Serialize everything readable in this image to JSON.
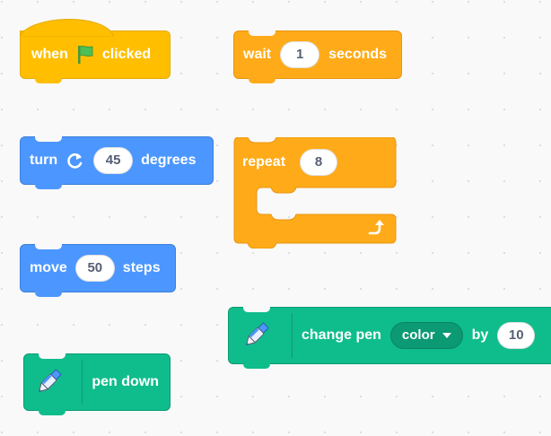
{
  "blocks": {
    "when_flag": {
      "prefix": "when",
      "suffix": "clicked",
      "flag_color": "#4cbf56"
    },
    "wait": {
      "label": "wait",
      "value": "1",
      "unit": "seconds"
    },
    "turn": {
      "label": "turn",
      "value": "45",
      "unit": "degrees"
    },
    "repeat": {
      "label": "repeat",
      "value": "8"
    },
    "move": {
      "label": "move",
      "value": "50",
      "unit": "steps"
    },
    "change_pen": {
      "label": "change pen",
      "dropdown": "color",
      "by": "by",
      "value": "10"
    },
    "pen_down": {
      "label": "pen down"
    }
  },
  "colors": {
    "events": "#ffbf00",
    "control": "#ffab19",
    "motion": "#4c97ff",
    "pen": "#0fbd8c",
    "canvas": "#f9f9f9"
  },
  "icons": [
    "green-flag-icon",
    "rotate-right-icon",
    "loop-arrow-icon",
    "pen-icon",
    "dropdown-caret-icon"
  ]
}
